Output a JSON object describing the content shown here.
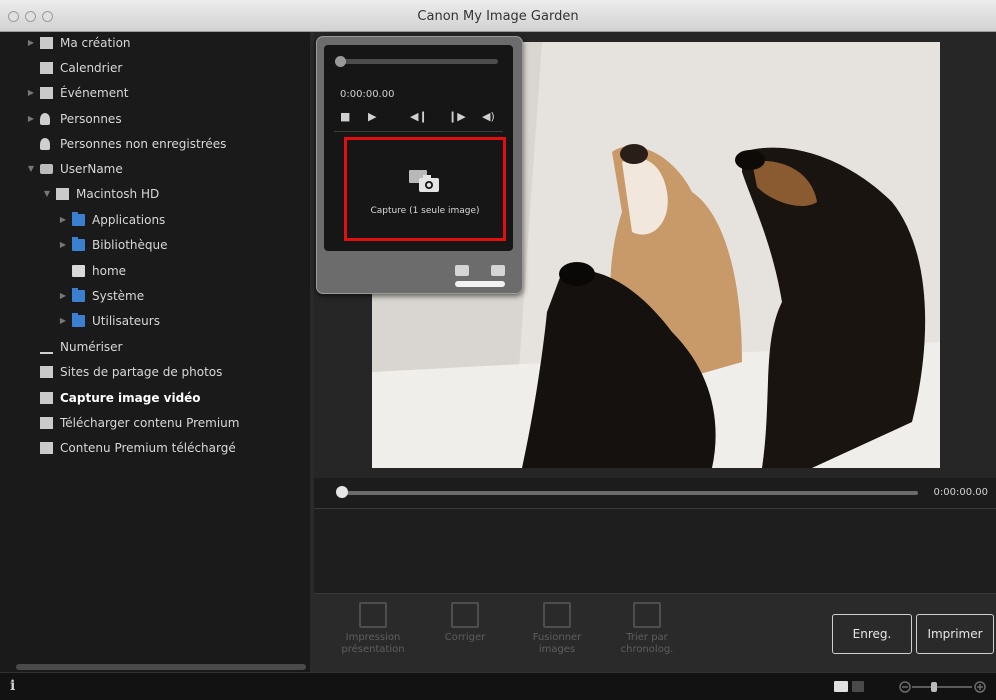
{
  "window": {
    "title": "Canon My Image Garden"
  },
  "sidebar": {
    "items": [
      {
        "label": "Ma création",
        "icon": "my-art-icon",
        "bold": false
      },
      {
        "label": "Calendrier",
        "icon": "calendar-icon",
        "bold": false
      },
      {
        "label": "Événement",
        "icon": "event-icon",
        "bold": false
      },
      {
        "label": "Personnes",
        "icon": "people-icon",
        "bold": false
      },
      {
        "label": "Personnes non enregistrées",
        "icon": "unregistered-people-icon",
        "bold": false
      },
      {
        "label": "UserName",
        "icon": "user-drive-icon",
        "bold": false
      },
      {
        "label": "Macintosh HD",
        "icon": "hard-disk-icon",
        "bold": false
      },
      {
        "label": "Applications",
        "icon": "folder-icon",
        "bold": false
      },
      {
        "label": "Bibliothèque",
        "icon": "folder-icon",
        "bold": false
      },
      {
        "label": "home",
        "icon": "document-icon",
        "bold": false
      },
      {
        "label": "Système",
        "icon": "folder-icon",
        "bold": false
      },
      {
        "label": "Utilisateurs",
        "icon": "folder-icon",
        "bold": false
      },
      {
        "label": "Numériser",
        "icon": "scan-icon",
        "bold": false
      },
      {
        "label": "Sites de partage de photos",
        "icon": "photo-sharing-icon",
        "bold": false
      },
      {
        "label": "Capture image vidéo",
        "icon": "video-frame-capture-icon",
        "bold": true
      },
      {
        "label": "Télécharger contenu Premium",
        "icon": "download-premium-icon",
        "bold": false
      },
      {
        "label": "Contenu Premium téléchargé",
        "icon": "folder-icon",
        "bold": false
      }
    ]
  },
  "player": {
    "time": "0:00:00.00",
    "capture_label": "Capture (1 seule image)",
    "controls": [
      "stop-icon",
      "play-icon",
      "previous-frame-icon",
      "next-frame-icon",
      "volume-icon"
    ]
  },
  "timeline": {
    "time": "0:00:00.00"
  },
  "toolbar": {
    "tools": [
      {
        "label": "Impression présentation"
      },
      {
        "label": "Corriger"
      },
      {
        "label": "Fusionner images"
      },
      {
        "label": "Trier par chronolog."
      }
    ],
    "save_label": "Enreg.",
    "print_label": "Imprimer"
  },
  "statusbar": {
    "info_label": "i"
  },
  "colors": {
    "capture_highlight": "#e01010",
    "folder": "#3a7fd0",
    "background": "#1c1c1c"
  }
}
